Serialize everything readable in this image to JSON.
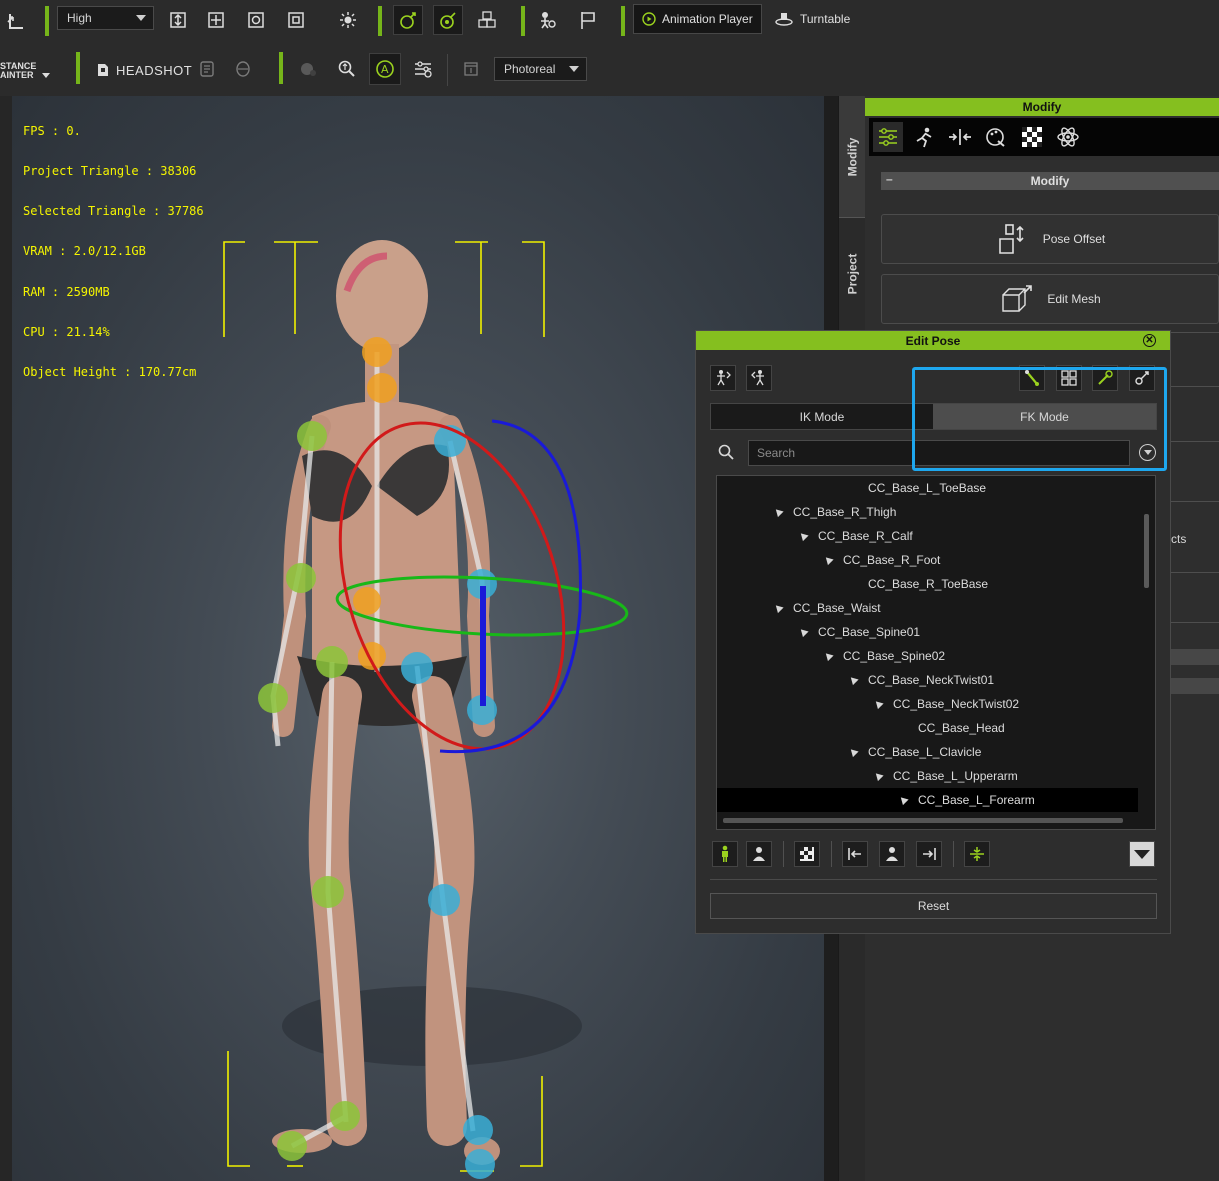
{
  "toolbar_top": {
    "quality_select": "High",
    "animation_player_label": "Animation Player",
    "turntable_label": "Turntable"
  },
  "toolbar_second": {
    "instance_painter_label_line1": "STANCE",
    "instance_painter_label_line2": "AINTER",
    "headshot_label": "HEADSHOT",
    "render_select": "Photoreal"
  },
  "viewport": {
    "stats": [
      "FPS : 0.",
      "Project Triangle : 38306",
      "Selected Triangle : 37786",
      "VRAM : 2.0/12.1GB",
      "RAM : 2590MB",
      "CPU : 21.14%",
      "Object Height : 170.77cm"
    ]
  },
  "side_tabs": {
    "modify": "Modify",
    "project": "Project"
  },
  "modify_panel": {
    "header": "Modify",
    "section_title": "Modify",
    "section_toggle": "–",
    "pose_offset_label": "Pose Offset",
    "edit_mesh_label": "Edit Mesh",
    "partial_text": "cts"
  },
  "edit_pose": {
    "title": "Edit Pose",
    "close_glyph": "✕",
    "ik_mode": "IK Mode",
    "fk_mode": "FK Mode",
    "search_placeholder": "Search",
    "reset_label": "Reset",
    "tree": [
      {
        "label": "CC_Base_L_ToeBase",
        "depth": 4,
        "expandable": false,
        "selected": false
      },
      {
        "label": "CC_Base_R_Thigh",
        "depth": 1,
        "expandable": true,
        "selected": false
      },
      {
        "label": "CC_Base_R_Calf",
        "depth": 2,
        "expandable": true,
        "selected": false
      },
      {
        "label": "CC_Base_R_Foot",
        "depth": 3,
        "expandable": true,
        "selected": false
      },
      {
        "label": "CC_Base_R_ToeBase",
        "depth": 4,
        "expandable": false,
        "selected": false
      },
      {
        "label": "CC_Base_Waist",
        "depth": 1,
        "expandable": true,
        "selected": false
      },
      {
        "label": "CC_Base_Spine01",
        "depth": 2,
        "expandable": true,
        "selected": false
      },
      {
        "label": "CC_Base_Spine02",
        "depth": 3,
        "expandable": true,
        "selected": false
      },
      {
        "label": "CC_Base_NeckTwist01",
        "depth": 4,
        "expandable": true,
        "selected": false
      },
      {
        "label": "CC_Base_NeckTwist02",
        "depth": 5,
        "expandable": true,
        "selected": false
      },
      {
        "label": "CC_Base_Head",
        "depth": 6,
        "expandable": false,
        "selected": false
      },
      {
        "label": "CC_Base_L_Clavicle",
        "depth": 4,
        "expandable": true,
        "selected": false
      },
      {
        "label": "CC_Base_L_Upperarm",
        "depth": 5,
        "expandable": true,
        "selected": false
      },
      {
        "label": "CC_Base_L_Forearm",
        "depth": 6,
        "expandable": true,
        "selected": true
      }
    ]
  },
  "colors": {
    "accent_green": "#85bf1f",
    "highlight_blue": "#1ea7ee",
    "stats_yellow": "#f5f500",
    "gizmo_red": "#d11a1a",
    "gizmo_green": "#18b818",
    "gizmo_blue": "#1a1ad8"
  }
}
